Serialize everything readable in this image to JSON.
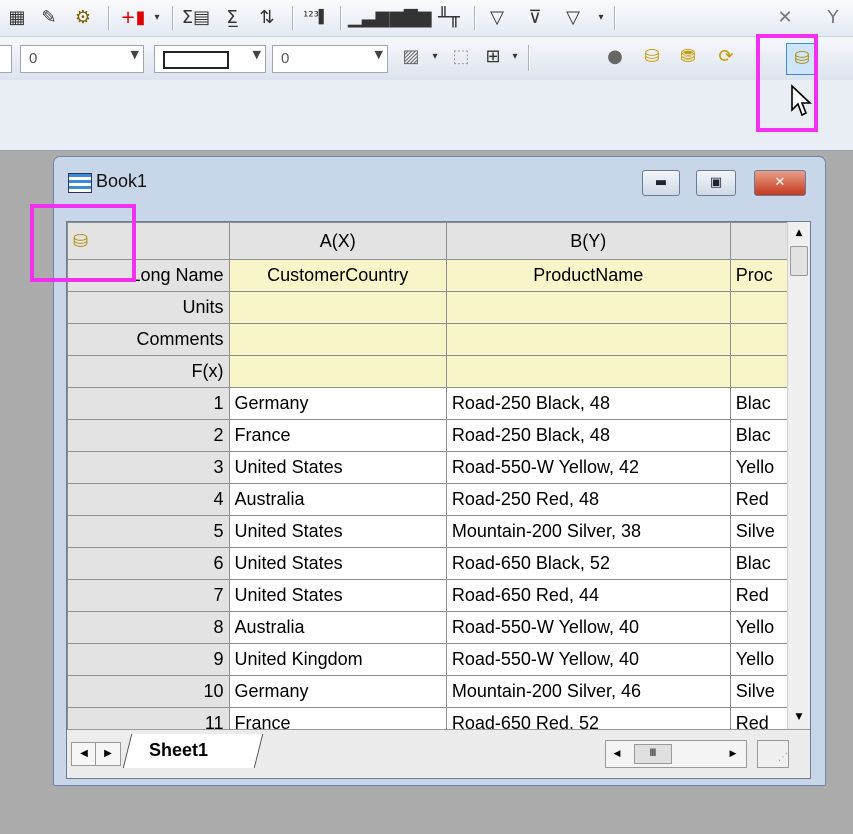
{
  "toolbar1": {
    "icons": [
      "worksheet-icon",
      "edit-icon",
      "gear-settings-icon",
      "add-column-icon",
      "sum-icon",
      "statistics-icon",
      "sort-icon",
      "number-format-icon",
      "bar-chart-icon",
      "column-chart-icon",
      "stat-chart-icon",
      "filter-icon",
      "remove-filter-icon",
      "reapply-filter-icon",
      "close-x-icon",
      "filter-y-icon"
    ]
  },
  "toolbar2": {
    "combo1_value": "0",
    "combo3_value": "0"
  },
  "workbook": {
    "title": "Book1",
    "columns": [
      {
        "header": "A(X)",
        "long_name": "CustomerCountry"
      },
      {
        "header": "B(Y)",
        "long_name": "ProductName"
      },
      {
        "header": "",
        "long_name": "Proc"
      }
    ],
    "row_labels": {
      "long_name": "Long Name",
      "units": "Units",
      "comments": "Comments",
      "fx": "F(x)"
    },
    "rows": [
      {
        "n": "1",
        "a": "Germany",
        "b": "Road-250 Black, 48",
        "c": "Blac"
      },
      {
        "n": "2",
        "a": "France",
        "b": "Road-250 Black, 48",
        "c": "Blac"
      },
      {
        "n": "3",
        "a": "United States",
        "b": "Road-550-W Yellow, 42",
        "c": "Yello"
      },
      {
        "n": "4",
        "a": "Australia",
        "b": "Road-250 Red, 48",
        "c": "Red"
      },
      {
        "n": "5",
        "a": "United States",
        "b": "Mountain-200 Silver, 38",
        "c": "Silve"
      },
      {
        "n": "6",
        "a": "United States",
        "b": "Road-650 Black, 52",
        "c": "Blac"
      },
      {
        "n": "7",
        "a": "United States",
        "b": "Road-650 Red, 44",
        "c": "Red"
      },
      {
        "n": "8",
        "a": "Australia",
        "b": "Road-550-W Yellow, 40",
        "c": "Yello"
      },
      {
        "n": "9",
        "a": "United Kingdom",
        "b": "Road-550-W Yellow, 40",
        "c": "Yello"
      },
      {
        "n": "10",
        "a": "Germany",
        "b": "Mountain-200 Silver, 46",
        "c": "Silve"
      },
      {
        "n": "11",
        "a": "France",
        "b": "Road-650 Red, 52",
        "c": "Red"
      }
    ],
    "sheet_tab": "Sheet1"
  },
  "colors": {
    "highlight": "#f130f1",
    "header_fill": "#e3e3e3",
    "label_row_fill": "#f8f6c8"
  }
}
